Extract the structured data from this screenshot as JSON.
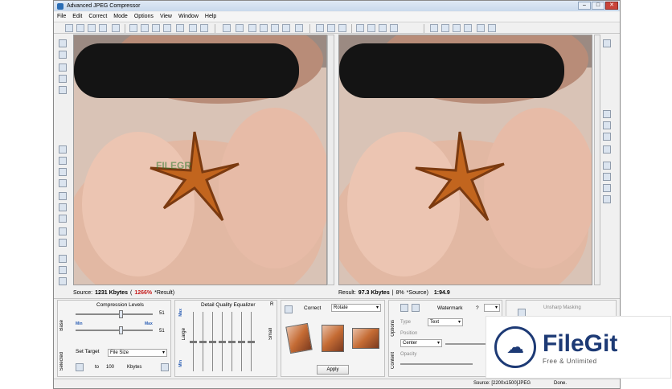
{
  "window": {
    "title": "Advanced JPEG Compressor",
    "min": "–",
    "max": "□",
    "close": "✕"
  },
  "menu": [
    "File",
    "Edit",
    "Correct",
    "Mode",
    "Options",
    "View",
    "Window",
    "Help"
  ],
  "left_pane": {
    "status_prefix": "Source:",
    "size": "1231 Kbytes",
    "ratio": "1266%",
    "suffix": "*Result)",
    "watermark_text": "FILEGR"
  },
  "right_pane": {
    "status_prefix": "Result:",
    "size": "97.3 Kbytes",
    "ratio": "8%",
    "suffix": "*Source)",
    "factor": "1:94.9"
  },
  "compression": {
    "title": "Compression Levels",
    "base_tab": "Base",
    "selected_tab": "Selected",
    "slider1_value": "51",
    "slider2_value": "51",
    "min_label": "Min",
    "max_label": "Max",
    "set_target_label": "Set Target",
    "target_mode": "File Size",
    "to_label": "to",
    "target_value": "100",
    "unit": "Kbytes"
  },
  "equalizer": {
    "title": "Detail Quality Equalizer",
    "right_label": "R",
    "large_label": "Large",
    "small_label": "Small",
    "max_label": "Max",
    "min_label": "Min"
  },
  "correct": {
    "label": "Correct",
    "mode": "Rotate",
    "apply": "Apply"
  },
  "watermark": {
    "title": "Watermark",
    "help": "?",
    "options_tab": "Options",
    "content_tab": "Content",
    "type_label": "Type",
    "type_value": "Text",
    "position_label": "Position",
    "position_value": "Center",
    "opacity_label": "Opacity"
  },
  "unsharp": {
    "title": "Unsharp Masking"
  },
  "statusbar": {
    "source": "Source: [2200x1500]JPEG",
    "done": "Done."
  },
  "logo": {
    "name": "FileGit",
    "tagline": "Free & Unlimited"
  },
  "colors": {
    "accent": "#1d3a75",
    "ratio_red": "#c62020",
    "slider_blue": "#2c5fb4"
  }
}
